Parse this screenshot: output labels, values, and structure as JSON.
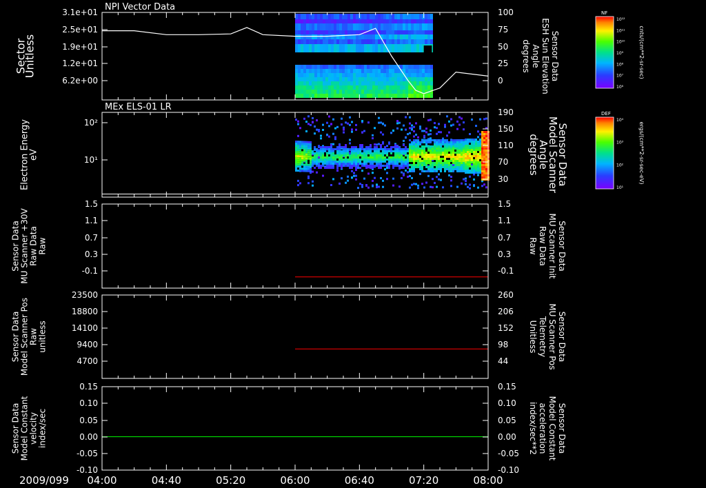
{
  "date_label": "2009/099",
  "time_ticks": [
    "04:00",
    "04:40",
    "05:20",
    "06:00",
    "06:40",
    "07:20",
    "08:00"
  ],
  "colors": {
    "background": "#000000",
    "axes": "#ffffff",
    "red_trace": "#ff0000",
    "green_trace": "#00ff00"
  },
  "panels": [
    {
      "title": "NPI Vector Data",
      "left_label": [
        "Sector",
        "Unitless"
      ],
      "right_label": [
        "Sensor Data",
        "ESH Sun Elevation",
        "Angle",
        "degrees"
      ],
      "left_ticks": [
        "3.1e+01",
        "2.5e+01",
        "1.9e+01",
        "1.2e+01",
        "6.2e+00"
      ],
      "right_ticks": [
        "100",
        "75",
        "50",
        "25",
        "0"
      ],
      "colorbar": {
        "title": "NF",
        "unit": "cnts/(cm**2-sr-sec)",
        "ticks": [
          "10¹²",
          "10¹¹",
          "10¹⁰",
          "10⁹",
          "10⁸",
          "10⁷",
          "10⁶"
        ]
      }
    },
    {
      "title": "MEx ELS-01 LR",
      "left_label": [
        "Electron Energy",
        "eV"
      ],
      "right_label": [
        "Sensor Data",
        "Model Scanner",
        "Angle",
        "degrees"
      ],
      "left_ticks": [
        "10²",
        "10¹"
      ],
      "right_ticks": [
        "190",
        "150",
        "110",
        "70",
        "30"
      ],
      "colorbar": {
        "title": "DEF",
        "unit": "ergs/(cm**2-sr-sec-eV)",
        "ticks": [
          "10⁴",
          "10³",
          "10²",
          "10¹"
        ]
      }
    },
    {
      "title": "",
      "left_label": [
        "Sensor Data",
        "MU Scanner +30V",
        "Raw Data",
        "Raw"
      ],
      "right_label": [
        "Sensor Data",
        "MU Scanner Init",
        "Raw Data",
        "Raw"
      ],
      "left_ticks": [
        "1.5",
        "1.1",
        "0.7",
        "0.3",
        "-0.1"
      ],
      "right_ticks": [
        "1.5",
        "1.1",
        "0.7",
        "0.3",
        "-0.1"
      ]
    },
    {
      "title": "",
      "left_label": [
        "Sensor Data",
        "Model Scanner Pos",
        "Raw",
        "unitless"
      ],
      "right_label": [
        "Sensor Data",
        "MU Scanner Pos",
        "Telemetry",
        "Unitless"
      ],
      "left_ticks": [
        "23500",
        "18800",
        "14100",
        "9400",
        "4700"
      ],
      "right_ticks": [
        "260",
        "206",
        "152",
        "98",
        "44"
      ]
    },
    {
      "title": "",
      "left_label": [
        "Sensor Data",
        "Model Constant",
        "velocity",
        "index/sec"
      ],
      "right_label": [
        "Sensor Data",
        "Model Constant",
        "acceleration",
        "index/sec**2"
      ],
      "left_ticks": [
        "0.15",
        "0.10",
        "0.05",
        "0.00",
        "-0.05",
        "-0.10"
      ],
      "right_ticks": [
        "0.15",
        "0.10",
        "0.05",
        "0.00",
        "-0.05",
        "-0.10"
      ]
    }
  ],
  "chart_data": [
    {
      "type": "heatmap",
      "panel": "NPI Vector Data",
      "x_range": [
        "04:00",
        "08:00"
      ],
      "data_start": "06:00",
      "data_end": "07:25",
      "line": {
        "name": "ESH Sun Elevation Angle",
        "x": [
          "04:00",
          "04:20",
          "04:40",
          "05:00",
          "05:20",
          "05:30",
          "05:40",
          "06:00",
          "06:20",
          "06:40",
          "06:50",
          "07:00",
          "07:10",
          "07:15",
          "07:20",
          "07:30",
          "07:40",
          "08:00"
        ],
        "y": [
          77,
          77,
          72,
          72,
          73,
          81,
          72,
          70,
          70,
          72,
          80,
          45,
          15,
          2,
          -2,
          5,
          25,
          20
        ],
        "ylim": [
          -10,
          100
        ]
      }
    },
    {
      "type": "heatmap",
      "panel": "MEx ELS-01 LR",
      "x_range": [
        "04:00",
        "08:00"
      ],
      "data_start": "06:00",
      "data_end": "08:00",
      "line": {
        "name": "Model Scanner Angle",
        "x": [
          "04:00",
          "08:00"
        ],
        "y": [
          7,
          7
        ],
        "ylim": [
          0,
          190
        ]
      }
    },
    {
      "type": "line",
      "panel": "MU Scanner",
      "x": [
        "06:00",
        "08:00"
      ],
      "y": [
        -0.06,
        -0.06
      ],
      "ylim": [
        -0.3,
        1.5
      ]
    },
    {
      "type": "line",
      "panel": "Scanner Pos",
      "x": [
        "06:00",
        "08:00"
      ],
      "y": [
        8300,
        8300
      ],
      "ylim": [
        0,
        23500
      ]
    },
    {
      "type": "line",
      "panel": "Model Constant",
      "x": [
        "04:00",
        "08:00"
      ],
      "y": [
        0,
        0
      ],
      "ylim": [
        -0.1,
        0.15
      ]
    }
  ]
}
